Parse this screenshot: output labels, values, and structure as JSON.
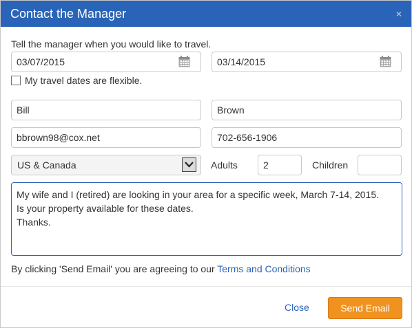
{
  "dialog": {
    "title": "Contact the Manager",
    "close_glyph": "×"
  },
  "intro": "Tell the manager when you would like to travel.",
  "dates": {
    "arrival": "03/07/2015",
    "departure": "03/14/2015",
    "icon": "calendar-icon"
  },
  "flexible": {
    "label": "My travel dates are flexible.",
    "checked": false
  },
  "contact": {
    "first_name": "Bill",
    "last_name": "Brown",
    "email": "bbrown98@cox.net",
    "phone": "702-656-1906"
  },
  "country": {
    "selected": "US & Canada"
  },
  "party": {
    "adults_label": "Adults",
    "adults_value": "2",
    "children_label": "Children",
    "children_value": ""
  },
  "message": "My wife and I (retired) are looking in your area for a specific week, March 7-14, 2015.\nIs your property available for these dates.\nThanks.",
  "terms": {
    "prefix": "By clicking 'Send Email' you are agreeing to our ",
    "link": "Terms and Conditions"
  },
  "footer": {
    "close_label": "Close",
    "send_label": "Send Email"
  },
  "colors": {
    "header": "#2a64b8",
    "link": "#2a64b8",
    "send_button": "#f0921f"
  }
}
